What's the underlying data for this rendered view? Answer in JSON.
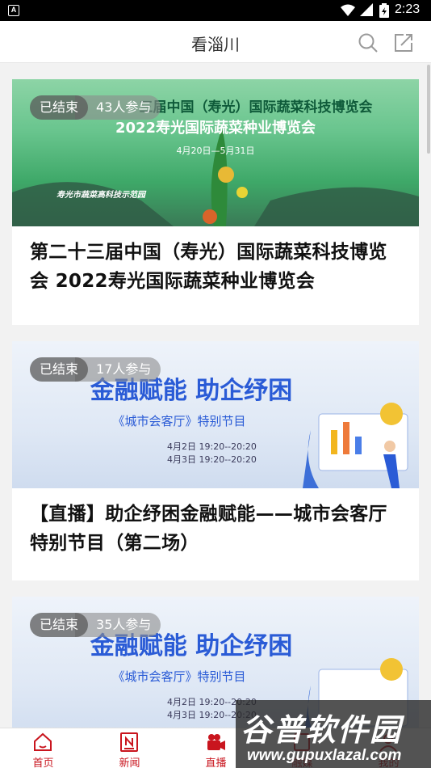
{
  "status_bar": {
    "time": "2:23",
    "app_icon_letter": "A"
  },
  "header": {
    "title": "看淄川",
    "search_icon": "search-icon",
    "share_icon": "share-icon"
  },
  "cards": [
    {
      "status": "已结束",
      "participants": "43人参与",
      "banner_lines": [
        "三届中国（寿光）国际蔬菜科技博览会",
        "2022寿光国际蔬菜种业博览会",
        "4月20日—5月31日",
        "寿光市蔬菜高科技示范园"
      ],
      "title": "第二十三届中国（寿光）国际蔬菜科技博览会 2022寿光国际蔬菜种业博览会"
    },
    {
      "status": "已结束",
      "participants": "17人参与",
      "banner_lines": [
        "金融赋能 助企纾困",
        "《城市会客厅》特别节目",
        "4月2日 19:20--20:20",
        "4月3日 19:20--20:20"
      ],
      "title": "【直播】助企纾困金融赋能——城市会客厅特别节目（第二场）"
    },
    {
      "status": "已结束",
      "participants": "35人参与",
      "banner_lines": [
        "金融赋能 助企纾困",
        "《城市会客厅》特别节目",
        "4月2日 19:20--20:20",
        "4月3日 19:20--20:20"
      ],
      "title": ""
    }
  ],
  "tabbar": {
    "tabs": [
      {
        "label": "首页",
        "icon": "home-icon"
      },
      {
        "label": "新闻",
        "icon": "news-icon"
      },
      {
        "label": "直播",
        "icon": "live-camera-icon"
      },
      {
        "label": "融媒",
        "icon": "media-icon"
      },
      {
        "label": "我的",
        "icon": "profile-icon"
      }
    ]
  },
  "watermark": {
    "text": "谷普软件园",
    "url": "www.gupuxlazal.com"
  },
  "colors": {
    "accent": "#c9151e",
    "badge_bg": "#5a5a5a",
    "banner1": "#69c58e",
    "banner2": "#dfe8f5",
    "banner_title_blue": "#2a5bd6"
  }
}
